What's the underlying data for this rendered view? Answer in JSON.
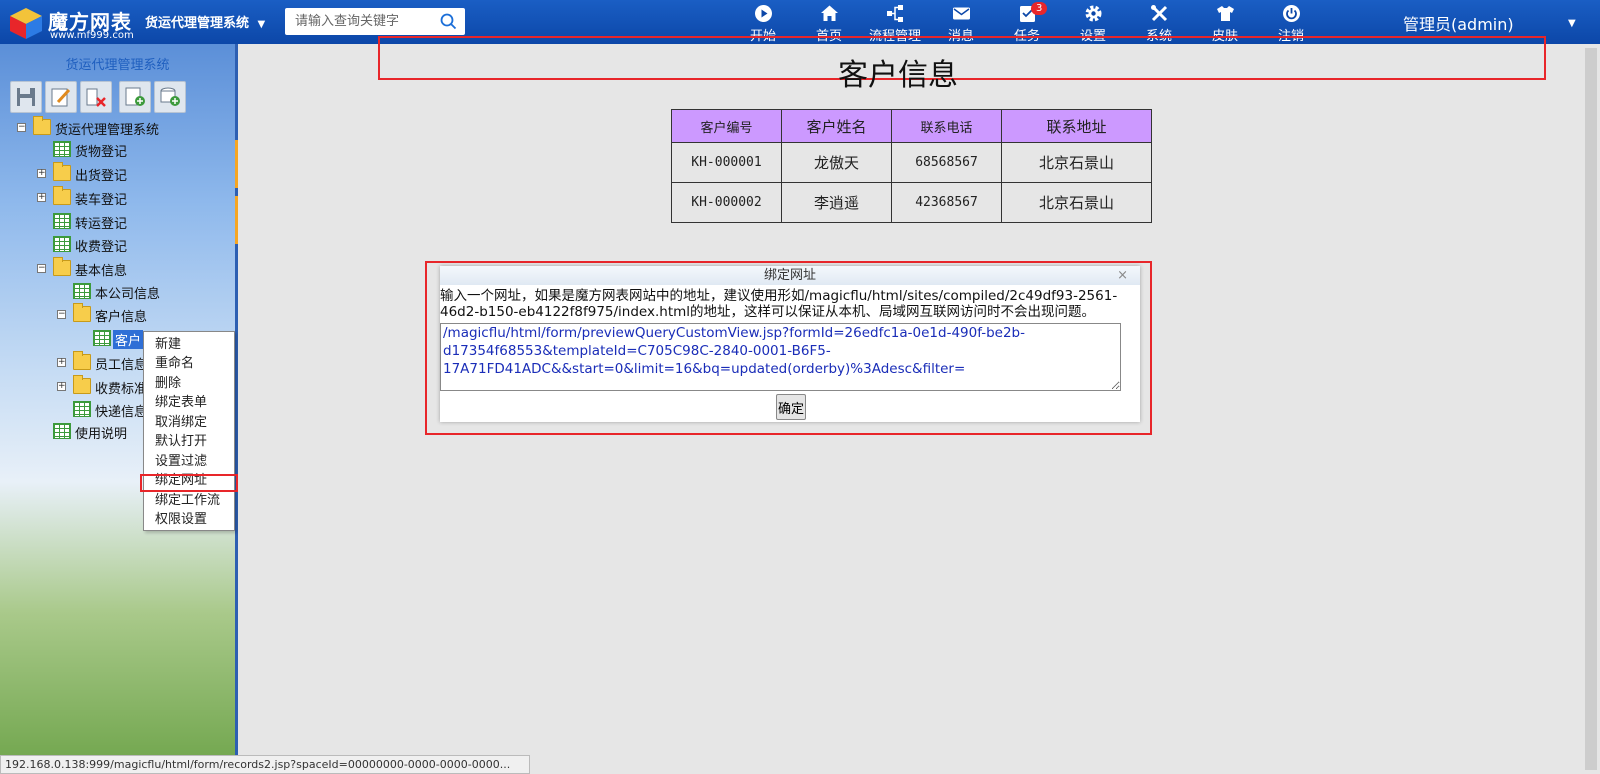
{
  "app": {
    "logo_name": "魔方网表",
    "logo_url": "www.mf999.com",
    "system_name": "货运代理管理系统",
    "system_caret": "▼"
  },
  "search": {
    "placeholder": "请输入查询关键字"
  },
  "nav": {
    "items": [
      {
        "label": "开始",
        "icon": "play-icon"
      },
      {
        "label": "首页",
        "icon": "home-icon"
      },
      {
        "label": "流程管理",
        "icon": "workflow-icon"
      },
      {
        "label": "消息",
        "icon": "mail-icon"
      },
      {
        "label": "任务",
        "icon": "task-icon",
        "badge": "3"
      },
      {
        "label": "设置",
        "icon": "gear-icon"
      },
      {
        "label": "系统",
        "icon": "tools-icon"
      },
      {
        "label": "皮肤",
        "icon": "shirt-icon"
      },
      {
        "label": "注销",
        "icon": "power-icon"
      }
    ],
    "user": "管理员(admin)",
    "user_caret": "▼"
  },
  "sidebar": {
    "title": "货运代理管理系统",
    "toolbar": [
      "save-icon",
      "edit-icon",
      "delete-icon",
      "add-form-icon",
      "add-data-icon"
    ],
    "tree": [
      {
        "label": "货运代理管理系统",
        "type": "folder",
        "toggle": "−"
      },
      {
        "label": "货物登记",
        "type": "grid"
      },
      {
        "label": "出货登记",
        "type": "folder",
        "toggle": "+"
      },
      {
        "label": "装车登记",
        "type": "folder",
        "toggle": "+"
      },
      {
        "label": "转运登记",
        "type": "grid"
      },
      {
        "label": "收费登记",
        "type": "grid"
      },
      {
        "label": "基本信息",
        "type": "folder",
        "toggle": "−"
      },
      {
        "label": "本公司信息",
        "type": "grid"
      },
      {
        "label": "客户信息",
        "type": "folder",
        "toggle": "−"
      },
      {
        "label": "客户",
        "type": "grid",
        "selected": true
      },
      {
        "label": "员工信息",
        "type": "folder",
        "toggle": "+"
      },
      {
        "label": "收费标准",
        "type": "folder",
        "toggle": "+"
      },
      {
        "label": "快递信息",
        "type": "grid"
      },
      {
        "label": "使用说明",
        "type": "grid"
      }
    ]
  },
  "context_menu": {
    "items": [
      "新建",
      "重命名",
      "删除",
      "绑定表单",
      "取消绑定",
      "默认打开",
      "设置过滤",
      "绑定网址",
      "绑定工作流",
      "权限设置"
    ],
    "highlighted": "绑定网址"
  },
  "main": {
    "title": "客户信息",
    "table": {
      "headers": [
        "客户编号",
        "客户姓名",
        "联系电话",
        "联系地址"
      ],
      "rows": [
        [
          "KH-000001",
          "龙傲天",
          "68568567",
          "北京石景山"
        ],
        [
          "KH-000002",
          "李逍遥",
          "42368567",
          "北京石景山"
        ]
      ],
      "header_color": "#cc99ff"
    }
  },
  "dialog": {
    "title": "绑定网址",
    "close": "×",
    "description": "输入一个网址，如果是魔方网表网站中的地址，建议使用形如/magicflu/html/sites/compiled/2c49df93-2561-46d2-b150-eb4122f8f975/index.html的地址，这样可以保证从本机、局域网互联网访问时不会出现问题。",
    "url_value": "/magicflu/html/form/previewQueryCustomView.jsp?formId=26edfc1a-0e1d-490f-be2b-d17354f68553&templateId=C705C98C-2840-0001-B6F5-17A71FD41ADC&&start=0&limit=16&bq=updated(orderby)%3Adesc&filter=",
    "ok_label": "确定"
  },
  "statusbar": {
    "text": "192.168.0.138:999/magicflu/html/form/records2.jsp?spaceId=00000000-0000-0000-0000..."
  },
  "colors": {
    "topbar": "#0c47a8",
    "highlight_border": "#e8262a",
    "badge": "#e8262a"
  }
}
